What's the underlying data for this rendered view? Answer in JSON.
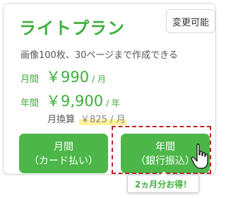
{
  "plan": {
    "title": "ライトプラン",
    "badge": "変更可能",
    "description": "画像100枚、30ページまで作成できる"
  },
  "pricing": {
    "monthly": {
      "label": "月間",
      "value": "￥990",
      "unit": "/ 月"
    },
    "yearly": {
      "label": "年間",
      "value": "￥9,900",
      "unit": "/ 年"
    },
    "conversion": {
      "label": "月換算",
      "value": "￥825 / 月"
    }
  },
  "buttons": {
    "monthly": {
      "line1": "月間",
      "line2": "（カード払い）"
    },
    "yearly": {
      "line1": "年間",
      "line2": "（銀行振込）"
    }
  },
  "tooltip": {
    "text": "2ヵ月分お得！"
  },
  "colors": {
    "accent": "#3faf3b",
    "button": "#4cb748",
    "highlight_border": "#c0262a",
    "marker": "#fff29a"
  },
  "icons": {
    "cursor": "hand-pointer-icon"
  }
}
